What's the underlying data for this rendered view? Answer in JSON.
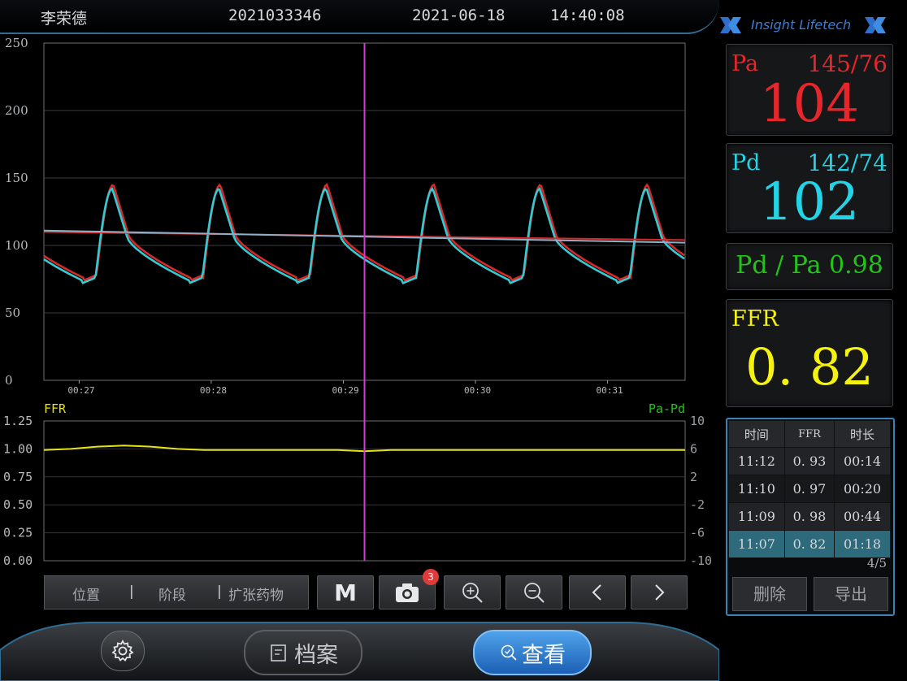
{
  "header": {
    "patient_name": "李荣德",
    "patient_id": "2021033346",
    "date": "2021-06-18",
    "time": "14:40:08"
  },
  "logo": {
    "text": "Insight Lifetech"
  },
  "panels": {
    "pa": {
      "label": "Pa",
      "sys_dia": "145/76",
      "mean": "104",
      "color": "#e6262b"
    },
    "pd": {
      "label": "Pd",
      "sys_dia": "142/74",
      "mean": "102",
      "color": "#22d4e6"
    },
    "ratio": {
      "text": "Pd / Pa 0.98",
      "color": "#25c31a"
    },
    "ffr": {
      "label": "FFR",
      "value": "0. 82",
      "color": "#f5f20f"
    }
  },
  "history": {
    "columns": [
      "时间",
      "FFR",
      "时长"
    ],
    "rows": [
      {
        "time": "11:12",
        "ffr": "0. 93",
        "dur": "00:14"
      },
      {
        "time": "11:10",
        "ffr": "0. 97",
        "dur": "00:20"
      },
      {
        "time": "11:09",
        "ffr": "0. 98",
        "dur": "00:44"
      },
      {
        "time": "11:07",
        "ffr": "0. 82",
        "dur": "01:18"
      }
    ],
    "selected_index": 3,
    "page": "4/5",
    "delete_label": "删除",
    "export_label": "导出"
  },
  "toolbar": {
    "position_label": "位置",
    "stage_label": "阶段",
    "drug_label": "扩张药物",
    "mark_label": "M",
    "snapshot_count": "3",
    "sep": "|"
  },
  "bottom": {
    "archive_label": "档案",
    "view_label": "查看"
  },
  "chart_data": [
    {
      "type": "line",
      "title": "",
      "ylim": [
        0,
        250
      ],
      "yticks": [
        "250",
        "200",
        "150",
        "100",
        "50",
        "0"
      ],
      "xticks": [
        "00:27",
        "00:28",
        "00:29",
        "00:30",
        "00:31"
      ],
      "cursor_x_fraction": 0.5,
      "series": [
        {
          "name": "Pa",
          "color": "#d42a2a",
          "mean": 104,
          "systolic": 145,
          "diastolic": 76,
          "beats": 6
        },
        {
          "name": "Pd",
          "color": "#35c9d2",
          "mean": 102,
          "systolic": 142,
          "diastolic": 74,
          "beats": 6
        }
      ],
      "mean_line_color": "#8fb0c8",
      "cursor_color": "#d43ad6"
    },
    {
      "type": "line",
      "ylim": [
        0,
        1.25
      ],
      "yticks": [
        "1.25",
        "1.00",
        "0.75",
        "0.50",
        "0.25",
        "0.00"
      ],
      "y2lim": [
        -10,
        10
      ],
      "y2ticks": [
        "10",
        "6",
        "2",
        "-2",
        "-6",
        "-10"
      ],
      "left_label": "FFR",
      "right_label": "Pa-Pd",
      "series": [
        {
          "name": "FFR",
          "color": "#e6e21a",
          "values": [
            0.99,
            1.0,
            1.02,
            1.03,
            1.02,
            1.0,
            0.99,
            0.99,
            0.99,
            0.99,
            0.99,
            0.99,
            0.98,
            0.99,
            0.99,
            0.99,
            0.99,
            0.99,
            0.99,
            0.99,
            0.99,
            0.99,
            0.99,
            0.99,
            0.99
          ]
        }
      ]
    }
  ]
}
